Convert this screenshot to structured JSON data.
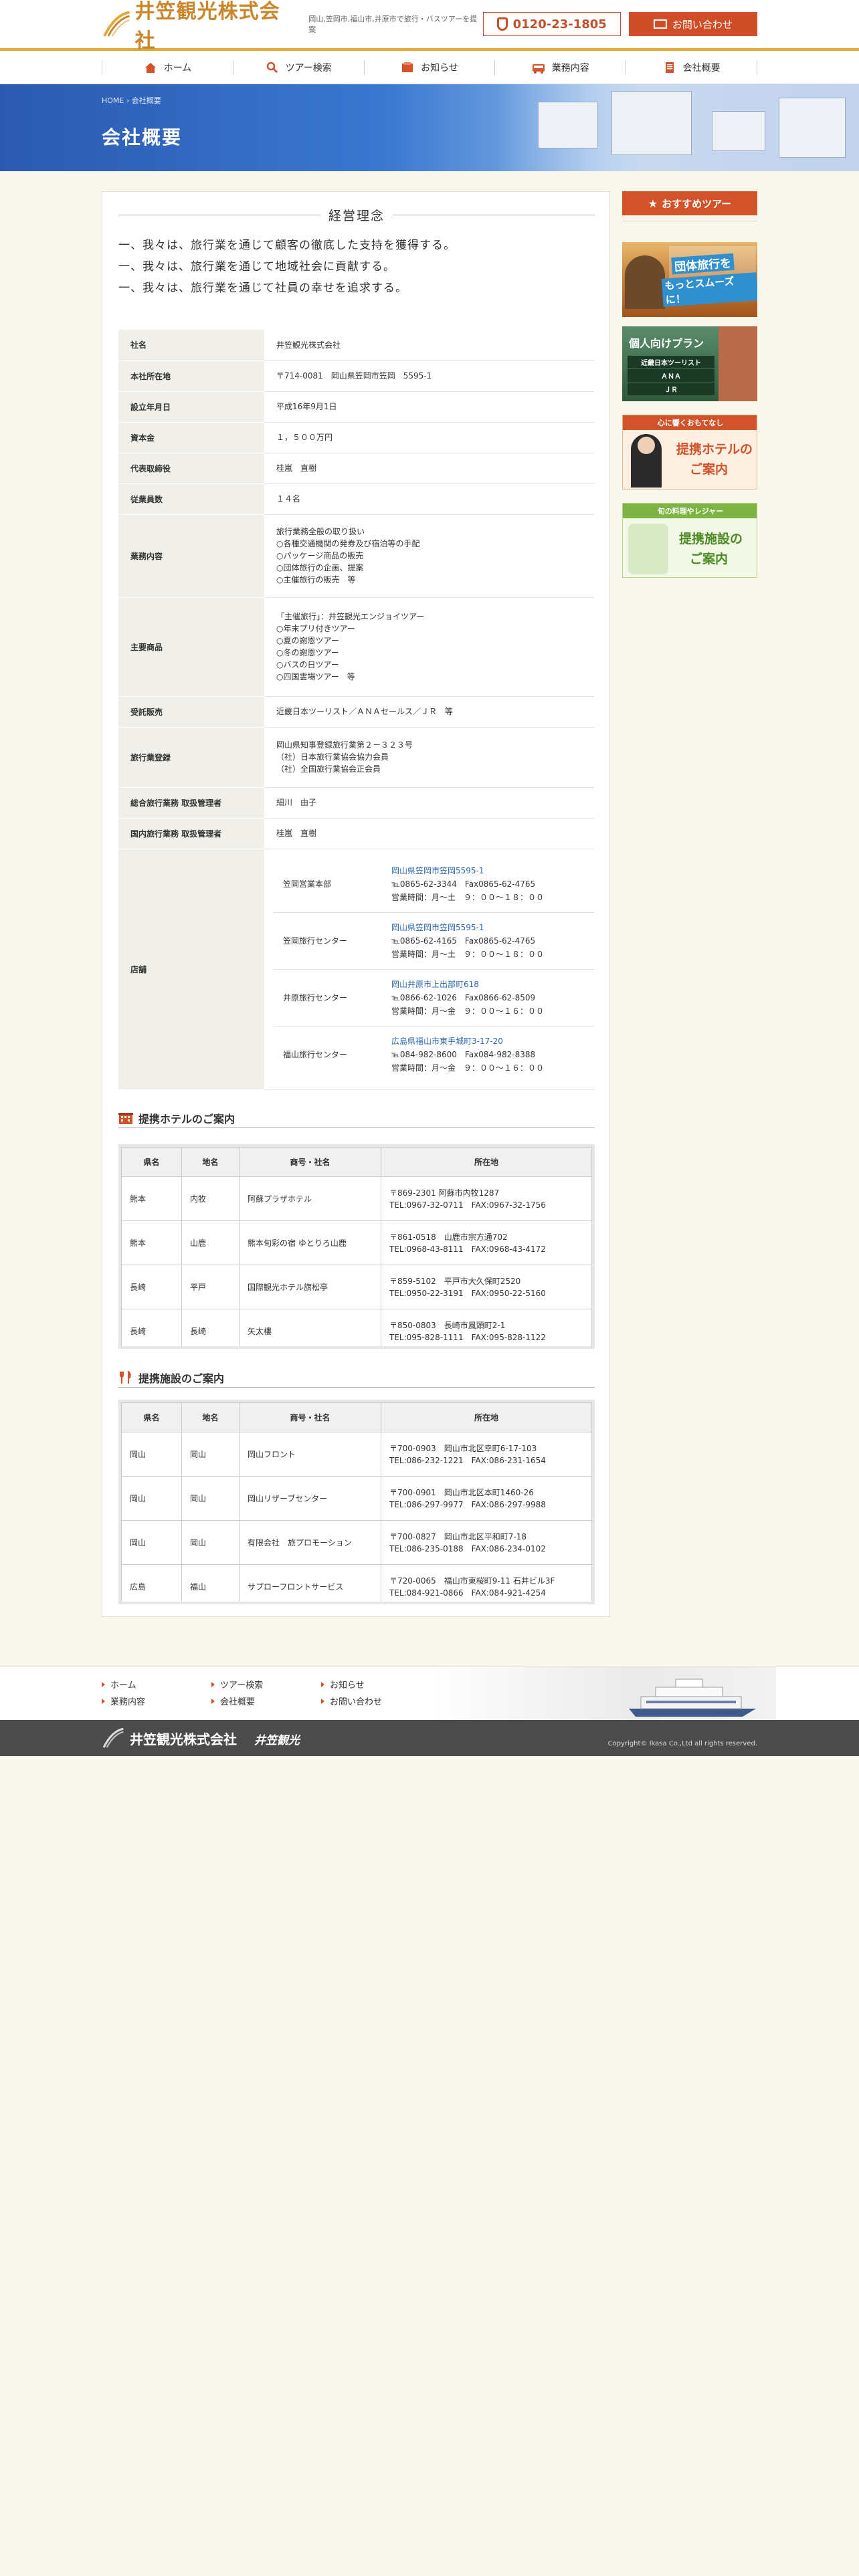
{
  "header": {
    "logo": "井笠観光株式会社",
    "tagline": "岡山,笠岡市,福山市,井原市で旅行・バスツアーを提案",
    "tel": "0120-23-1805",
    "contact": "お問い合わせ"
  },
  "nav": [
    {
      "label": "ホーム",
      "icon": "home-icon"
    },
    {
      "label": "ツアー検索",
      "icon": "search-icon"
    },
    {
      "label": "お知らせ",
      "icon": "notice-icon"
    },
    {
      "label": "業務内容",
      "icon": "bus-icon"
    },
    {
      "label": "会社概要",
      "icon": "document-icon"
    }
  ],
  "banner": {
    "breadcrumb": "HOME › 会社概要",
    "title": "会社概要"
  },
  "philosophy": {
    "title": "経営理念",
    "lines": [
      "一、我々は、旅行業を通じて顧客の徹底した支持を獲得する。",
      "一、我々は、旅行業を通じて地域社会に貢献する。",
      "一、我々は、旅行業を通じて社員の幸せを追求する。"
    ]
  },
  "company": {
    "rows": [
      {
        "label": "社名",
        "value": "井笠観光株式会社"
      },
      {
        "label": "本社所在地",
        "value": "〒714-0081　岡山県笠岡市笠岡　5595-1"
      },
      {
        "label": "設立年月日",
        "value": "平成16年9月1日"
      },
      {
        "label": "資本金",
        "value": "１，５００万円"
      },
      {
        "label": "代表取締役",
        "value": "桂嵐　直樹"
      },
      {
        "label": "従業員数",
        "value": "１４名"
      },
      {
        "label": "業務内容",
        "value": "旅行業務全般の取り扱い\n○各種交通機関の発券及び宿泊等の手配\n○パッケージ商品の販売\n○団体旅行の企画、提案\n○主催旅行の販売　等"
      },
      {
        "label": "主要商品",
        "value": "「主催旅行」：井笠観光エンジョイツアー\n○年末プリ付きツアー\n○夏の謝恩ツアー\n○冬の謝恩ツアー\n○バスの日ツアー\n○四国霊場ツアー　等"
      },
      {
        "label": "受託販売",
        "value": "近畿日本ツーリスト／ＡＮＡセールス／ＪＲ　等"
      },
      {
        "label": "旅行業登録",
        "value": "岡山県知事登録旅行業第２－３２３号\n（社）日本旅行業協会協力会員\n（社）全国旅行業協会正会員"
      },
      {
        "label": "総合旅行業務 取扱管理者",
        "value": "細川　由子"
      },
      {
        "label": "国内旅行業務 取扱管理者",
        "value": "桂嵐　直樹"
      }
    ],
    "shops_label": "店舗",
    "shops": [
      {
        "name": "笠岡営業本部",
        "addr": "岡山県笠岡市笠岡5595-1",
        "tel": "℡0865-62-3344　Fax0865-62-4765",
        "hours": "営業時間：月～土　９：００～１８：００"
      },
      {
        "name": "笠岡旅行センター",
        "addr": "岡山県笠岡市笠岡5595-1",
        "tel": "℡0865-62-4165　Fax0865-62-4765",
        "hours": "営業時間：月～土　９：００～１８：００"
      },
      {
        "name": "井原旅行センター",
        "addr": "岡山井原市上出部町618",
        "tel": "℡0866-62-1026　Fax0866-62-8509",
        "hours": "営業時間：月～金　９：００～１６：００"
      },
      {
        "name": "福山旅行センター",
        "addr": "広島県福山市東手城町3-17-20",
        "tel": "℡084-982-8600　Fax084-982-8388",
        "hours": "営業時間：月～金　９：００～１６：００"
      }
    ]
  },
  "hotels": {
    "title": "提携ホテルのご案内",
    "headers": [
      "県名",
      "地名",
      "商号・社名",
      "所在地"
    ],
    "rows": [
      [
        "熊本",
        "内牧",
        "阿蘇プラザホテル",
        "〒869-2301 阿蘇市内牧1287\nTEL:0967-32-0711　FAX:0967-32-1756"
      ],
      [
        "熊本",
        "山鹿",
        "熊本旬彩の宿 ゆとりろ山鹿",
        "〒861-0518　山鹿市宗方通702\nTEL:0968-43-8111　FAX:0968-43-4172"
      ],
      [
        "長崎",
        "平戸",
        "国際観光ホテル旗松亭",
        "〒859-5102　平戸市大久保町2520\nTEL:0950-22-3191　FAX:0950-22-5160"
      ],
      [
        "長崎",
        "長崎",
        "矢太樓",
        "〒850-0803　長崎市風頭町2-1\nTEL:095-828-1111　FAX:095-828-1122"
      ]
    ]
  },
  "facilities": {
    "title": "提携施設のご案内",
    "headers": [
      "県名",
      "地名",
      "商号・社名",
      "所在地"
    ],
    "rows": [
      [
        "岡山",
        "岡山",
        "岡山フロント",
        "〒700-0903　岡山市北区幸町6-17-103\nTEL:086-232-1221　FAX:086-231-1654"
      ],
      [
        "岡山",
        "岡山",
        "岡山リザーブセンター",
        "〒700-0901　岡山市北区本町1460-26\nTEL:086-297-9977　FAX:086-297-9988"
      ],
      [
        "岡山",
        "岡山",
        "有限会社　旅プロモーション",
        "〒700-0827　岡山市北区平和町7-18\nTEL:086-235-0188　FAX:086-234-0102"
      ],
      [
        "広島",
        "福山",
        "サプローフロントサービス",
        "〒720-0065　福山市東桜町9-11 石井ビル3F\nTEL:084-921-0866　FAX:084-921-4254"
      ]
    ]
  },
  "sidebar": {
    "recommend": "おすすめツアー",
    "b1_l1": "団体旅行を",
    "b1_l2": "もっとスムーズに！",
    "b2_l1": "個人向けプラン",
    "b2_l2": "近畿日本ツーリスト",
    "b2_l3": "ＡＮＡ",
    "b2_l4": "ＪＲ",
    "b3_top": "心に響くおもてなし",
    "b3_l1": "提携ホテルの",
    "b3_l2": "ご案内",
    "b4_top": "旬の料理やレジャー",
    "b4_l1": "提携施設の",
    "b4_l2": "ご案内"
  },
  "footer": {
    "links": [
      "ホーム",
      "ツアー検索",
      "お知らせ",
      "業務内容",
      "会社概要",
      "お問い合わせ"
    ],
    "logo": "井笠観光株式会社",
    "sublogo": "井笠観光",
    "copyright": "Copyright© Ikasa Co.,Ltd all rights reserved."
  },
  "colors": {
    "accent": "#cf4e27",
    "gold": "#e2a73a",
    "banner": "#2b59b0"
  }
}
